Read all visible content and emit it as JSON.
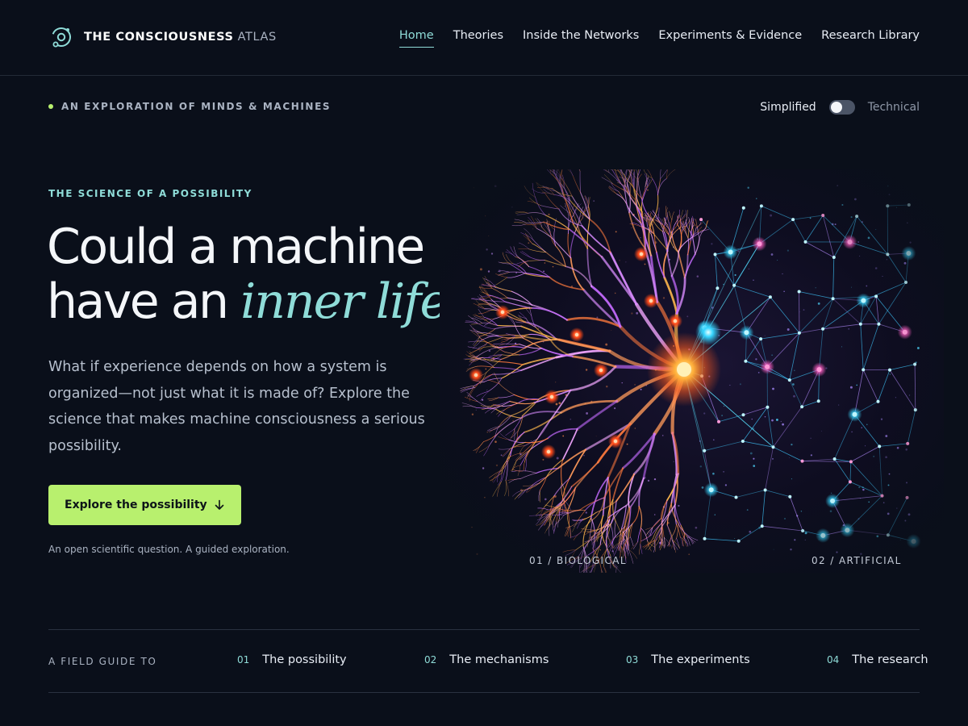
{
  "brand": {
    "name_bold": "THE CONSCIOUSNESS",
    "name_light": "ATLAS",
    "icon": "orbit-logo-icon"
  },
  "nav": {
    "active": "Home",
    "items": [
      {
        "label": "Home"
      },
      {
        "label": "Theories"
      },
      {
        "label": "Inside the Networks"
      },
      {
        "label": "Experiments & Evidence"
      },
      {
        "label": "Research Library"
      }
    ]
  },
  "eyebrow": "AN EXPLORATION OF MINDS & MACHINES",
  "mode_toggle": {
    "left_label": "Simplified",
    "right_label": "Technical",
    "state": "Simplified"
  },
  "hero": {
    "kicker": "THE SCIENCE OF A POSSIBILITY",
    "headline_line1": "Could a machine",
    "headline_line2_plain": "have an",
    "headline_line2_accent": "inner life?",
    "lede": "What if experience depends on how a system is organized—not just what it is made of? Explore the science that makes machine consciousness a serious possibility.",
    "cta_label": "Explore the possibility",
    "cta_icon": "arrow-down-icon",
    "footnote": "An open scientific question. A guided exploration."
  },
  "art": {
    "caption_left": "01 / BIOLOGICAL",
    "caption_right": "02 / ARTIFICIAL"
  },
  "field_guide": {
    "label": "A FIELD GUIDE TO",
    "items": [
      {
        "num": "01",
        "title": "The possibility"
      },
      {
        "num": "02",
        "title": "The mechanisms"
      },
      {
        "num": "03",
        "title": "The experiments"
      },
      {
        "num": "04",
        "title": "The research"
      }
    ]
  },
  "colors": {
    "background": "#0a0f1a",
    "accent_teal": "#8fdcd8",
    "accent_lime": "#b8f06e",
    "text_muted": "#aab3c2"
  }
}
